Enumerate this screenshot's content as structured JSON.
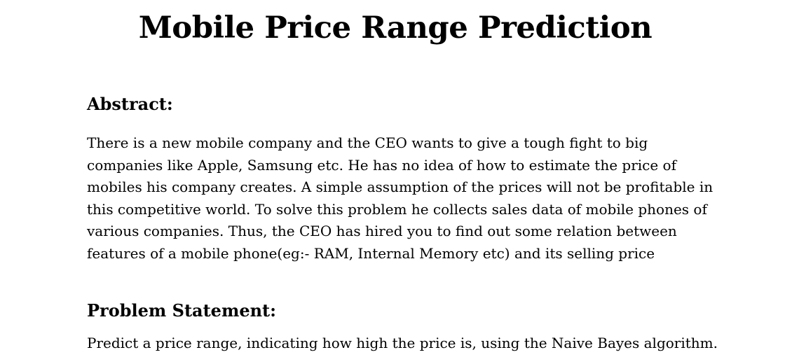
{
  "document": {
    "title": "Mobile Price Range Prediction",
    "sections": [
      {
        "heading": "Abstract:",
        "lines": [
          "There is a new mobile company and the CEO wants to give a tough fight to big",
          "companies like Apple, Samsung etc. He has no idea of how to estimate the price of",
          "mobiles his company creates. A simple assumption of the prices will not be profitable in",
          "this competitive world. To solve this problem he collects sales data of mobile phones of",
          "various companies. Thus, the CEO has hired you to find out some relation between",
          "features of a mobile phone(eg:- RAM, Internal Memory etc) and its selling price"
        ]
      },
      {
        "heading": "Problem Statement:",
        "lines": [
          "Predict a price range, indicating how high the price is, using the Naive Bayes algorithm."
        ]
      }
    ]
  }
}
